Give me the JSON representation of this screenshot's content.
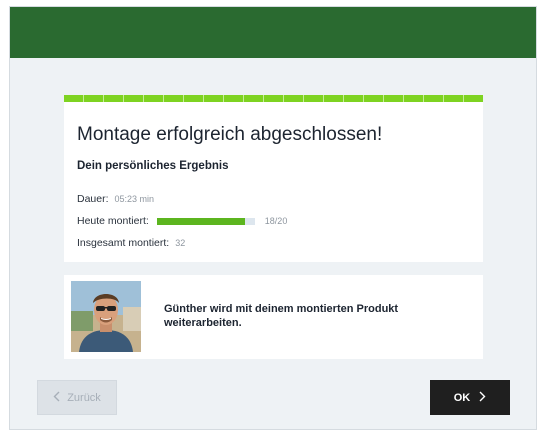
{
  "header": {
    "color": "#2a6a30"
  },
  "result": {
    "title": "Montage erfolgreich abgeschlossen!",
    "subtitle": "Dein persönliches Ergebnis",
    "duration_label": "Dauer:",
    "duration_value": "05:23 min",
    "today_label": "Heute montiert:",
    "today_progress": 0.9,
    "today_count": "18/20",
    "total_label": "Insgesamt montiert:",
    "total_value": "32",
    "stripe_color": "#7ed321"
  },
  "handover": {
    "message": "Günther wird mit deinem montierten Produkt weiterarbeiten.",
    "avatar_icon": "person-photo"
  },
  "buttons": {
    "back_label": "Zurück",
    "back_icon": "chevron-left-icon",
    "ok_label": "OK",
    "ok_icon": "chevron-right-icon"
  }
}
